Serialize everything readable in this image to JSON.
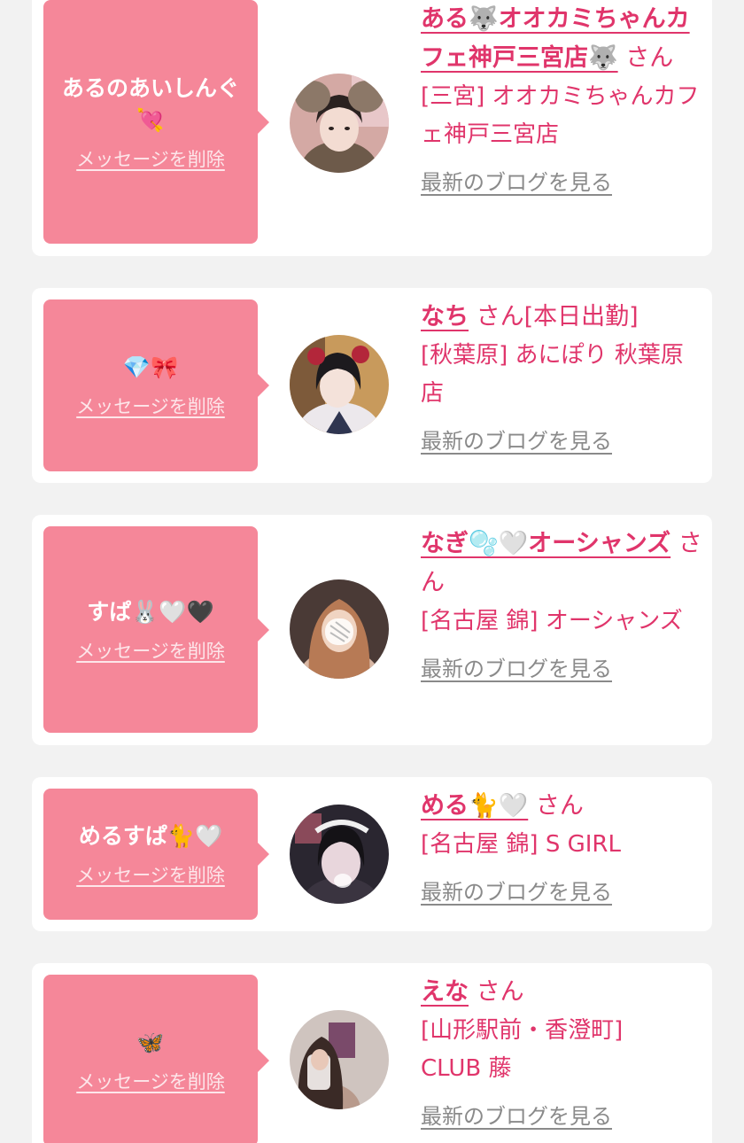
{
  "items": [
    {
      "nickname": "あるのあいしんぐ\n💘",
      "delete_label": "メッセージを削除",
      "name": "ある🐺オオカミちゃんカフェ神戸三宮店🐺",
      "honorific": "さん",
      "status": "",
      "shop": "[三宮] オオカミちゃんカフェ神戸三宮店",
      "blog_label": "最新のブログを見る",
      "avatar_icon": "cat-ear-girl-photo"
    },
    {
      "nickname": "💎🎀",
      "delete_label": "メッセージを削除",
      "name": "なち",
      "honorific": "さん",
      "status": "[本日出勤]",
      "shop": "[秋葉原] あにぽり 秋葉原店",
      "blog_label": "最新のブログを見る",
      "avatar_icon": "maid-girl-photo"
    },
    {
      "nickname": "すぱ🐰🤍🖤",
      "delete_label": "メッセージを削除",
      "name": "なぎ🫧🤍オーシャンズ",
      "honorific": "さん",
      "status": "",
      "shop": "[名古屋 錦] オーシャンズ",
      "blog_label": "最新のブログを見る",
      "avatar_icon": "girl-photo-blurred"
    },
    {
      "nickname": "めるすぱ🐈🤍",
      "delete_label": "メッセージを削除",
      "name": "める🐈🤍",
      "honorific": "さん",
      "status": "",
      "shop": "[名古屋 錦] S GIRL",
      "blog_label": "最新のブログを見る",
      "avatar_icon": "maid-headband-photo"
    },
    {
      "nickname": "🦋",
      "delete_label": "メッセージを削除",
      "name": "えな",
      "honorific": "さん",
      "status": "",
      "shop": "[山形駅前・香澄町] CLUB 藤",
      "blog_label": "最新のブログを見る",
      "avatar_icon": "mirror-selfie-photo"
    }
  ]
}
